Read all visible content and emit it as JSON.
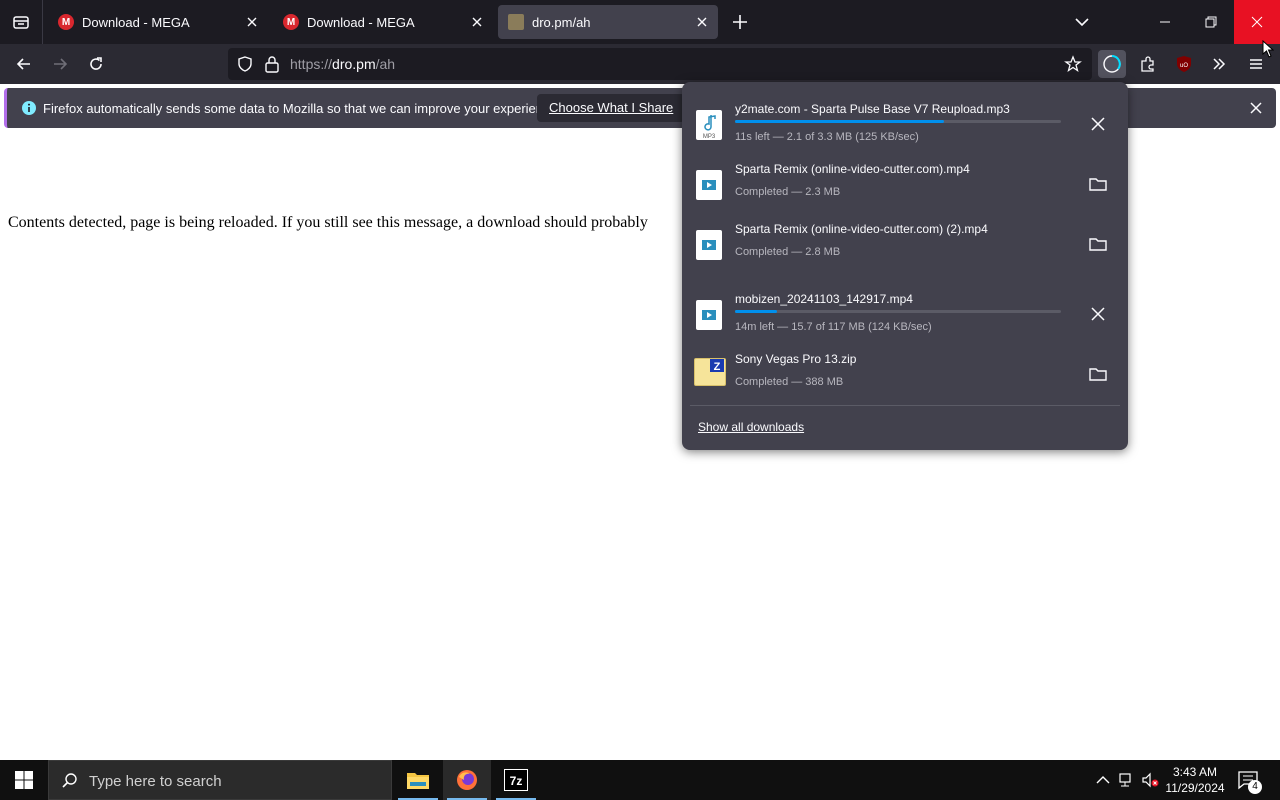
{
  "browser": {
    "tabs": [
      {
        "title": "Download - MEGA",
        "favicon": "mega-icon",
        "active": false
      },
      {
        "title": "Download - MEGA",
        "favicon": "mega-icon",
        "active": false
      },
      {
        "title": "dro.pm/ah",
        "favicon": "dro-icon",
        "active": true
      }
    ],
    "mega_letter": "M",
    "url_scheme": "https://",
    "url_host": "dro.pm",
    "url_path": "/ah"
  },
  "notification": {
    "text": "Firefox automatically sends some data to Mozilla so that we can improve your experience.",
    "button_label": "Choose What I Share"
  },
  "page": {
    "message": "Contents detected, page is being reloaded. If you still see this message, a download should probably"
  },
  "downloads": {
    "items": [
      {
        "name": "y2mate.com - Sparta Pulse Base V7 Reupload.mp3",
        "status": "11s left — 2.1 of 3.3 MB (125 KB/sec)",
        "progress": 0.64,
        "action": "cancel",
        "icon": "mp3-file-icon",
        "icon_label": "MP3"
      },
      {
        "name": "Sparta Remix (online-video-cutter.com).mp4",
        "status": "Completed — 2.3 MB",
        "progress": null,
        "action": "folder",
        "icon": "video-file-icon"
      },
      {
        "name": "Sparta Remix (online-video-cutter.com) (2).mp4",
        "status": "Completed — 2.8 MB",
        "progress": null,
        "action": "folder",
        "icon": "video-file-icon"
      },
      {
        "name": "mobizen_20241103_142917.mp4",
        "status": "14m left — 15.7 of 117 MB (124 KB/sec)",
        "progress": 0.13,
        "action": "cancel",
        "icon": "video-file-icon"
      },
      {
        "name": "Sony Vegas Pro 13.zip",
        "status": "Completed — 388 MB",
        "progress": null,
        "action": "folder",
        "icon": "zip-folder-icon",
        "icon_label": "Z"
      }
    ],
    "show_all_label": "Show all downloads"
  },
  "taskbar": {
    "search_placeholder": "Type here to search",
    "time": "3:43 AM",
    "date": "11/29/2024",
    "notification_count": "4",
    "apps": [
      "file-explorer-icon",
      "firefox-icon",
      "7zip-icon"
    ],
    "sevenzip_label": "7z"
  },
  "colors": {
    "close_hover": "#e81123",
    "progress": "#0090ed",
    "panel_bg": "#42414d",
    "toolbar_bg": "#2b2a33"
  }
}
